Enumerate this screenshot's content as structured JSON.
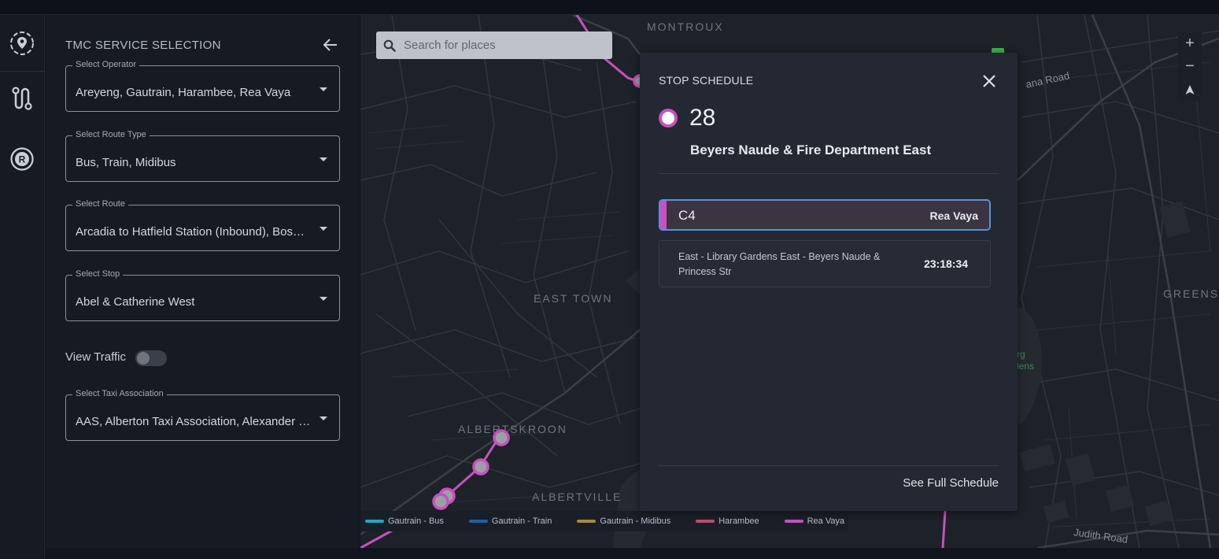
{
  "panel": {
    "title": "TMC SERVICE SELECTION",
    "fields": {
      "operator": {
        "label": "Select Operator",
        "value": "Areyeng, Gautrain, Harambee, Rea Vaya"
      },
      "route_type": {
        "label": "Select Route Type",
        "value": "Bus, Train, Midibus"
      },
      "route": {
        "label": "Select Route",
        "value": "Arcadia to Hatfield Station (Inbound), Bosmans Crossing to Hatfield Station"
      },
      "stop": {
        "label": "Select Stop",
        "value": "Abel & Catherine West"
      },
      "taxi": {
        "label": "Select Taxi Association",
        "value": "AAS, Alberton Taxi Association, Alexander Midibus Association"
      }
    },
    "traffic_label": "View Traffic",
    "traffic_on": false
  },
  "map": {
    "search_placeholder": "Search for places",
    "zoom_in": "+",
    "zoom_out": "−",
    "areas": {
      "montroux": "MONTROUX",
      "east_town": "EAST TOWN",
      "albertskroon": "ALBERTSKROON",
      "albertville": "ALBERTVILLE",
      "greensi": "GREENSI"
    },
    "roads": {
      "ana_road": "ana Road",
      "judith_road": "Judith Road"
    },
    "park": {
      "line1": "rg",
      "line2": "lens"
    },
    "legend": [
      {
        "label": "Gautrain - Bus",
        "color": "#2aa6c8"
      },
      {
        "label": "Gautrain - Train",
        "color": "#1f5fa8"
      },
      {
        "label": "Gautrain - Midibus",
        "color": "#a88a3a"
      },
      {
        "label": "Harambee",
        "color": "#b8506e"
      },
      {
        "label": "Rea Vaya",
        "color": "#c850c0"
      }
    ]
  },
  "popup": {
    "title": "STOP SCHEDULE",
    "stop_number": "28",
    "stop_name": "Beyers Naude & Fire Department East",
    "route_code": "C4",
    "route_operator": "Rea Vaya",
    "route_color": "#c850c0",
    "trip_description": "East - Library Gardens East - Beyers Naude & Princess Str",
    "trip_time": "23:18:34",
    "full_schedule_link": "See Full Schedule"
  }
}
